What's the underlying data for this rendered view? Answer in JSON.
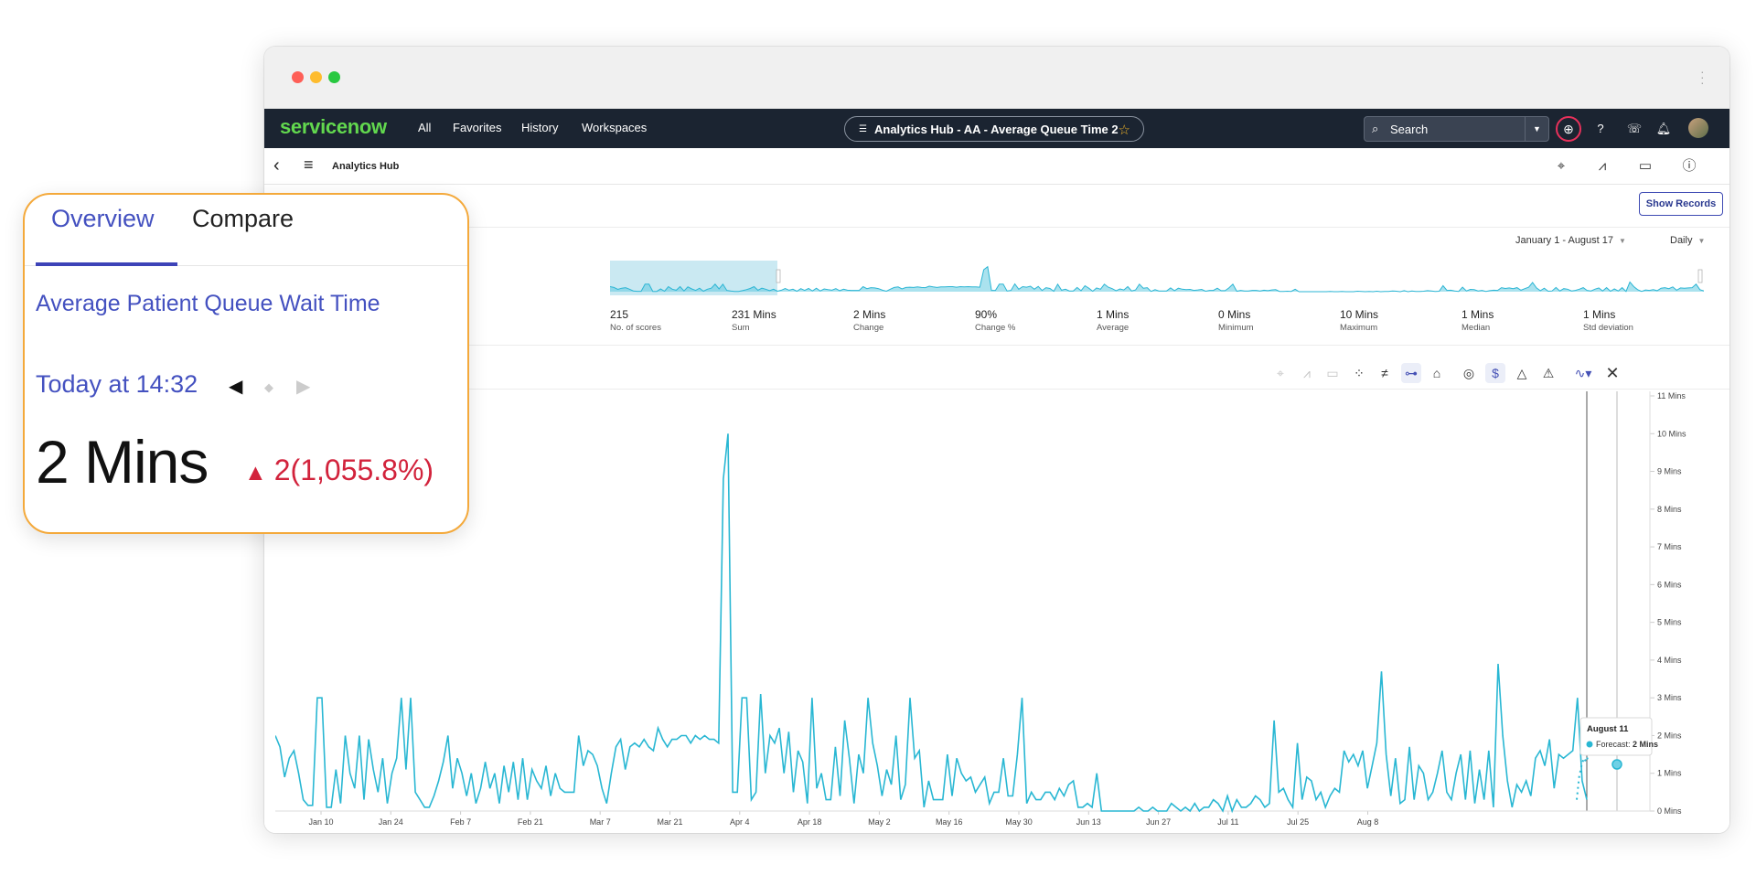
{
  "brand": {
    "logo_text": "servicenow",
    "accent_green": "#62d84e",
    "nav_bg": "#1b2431"
  },
  "nav": {
    "links": [
      "All",
      "Favorites",
      "History",
      "Workspaces"
    ],
    "page_pill": "Analytics Hub - AA - Average Queue Time 2",
    "search_placeholder": "Search",
    "icons": [
      "globe-icon",
      "help-icon",
      "phone-icon",
      "bell-icon",
      "user-avatar"
    ]
  },
  "subheader": {
    "title": "Analytics Hub",
    "icons": [
      "target-icon",
      "chart-forecast-icon",
      "comment-icon",
      "info-icon"
    ]
  },
  "header_actions": {
    "show_records": "Show Records"
  },
  "filters": {
    "date_range": "January 1 - August 17",
    "frequency": "Daily"
  },
  "stats": [
    {
      "value": "215",
      "label": "No. of scores"
    },
    {
      "value": "231 Mins",
      "label": "Sum"
    },
    {
      "value": "2 Mins",
      "label": "Change"
    },
    {
      "value": "90%",
      "label": "Change %"
    },
    {
      "value": "1 Mins",
      "label": "Average"
    },
    {
      "value": "0 Mins",
      "label": "Minimum"
    },
    {
      "value": "10 Mins",
      "label": "Maximum"
    },
    {
      "value": "1 Mins",
      "label": "Median"
    },
    {
      "value": "1 Mins",
      "label": "Std deviation"
    }
  ],
  "tooltip": {
    "date": "August 11",
    "label": "Forecast:",
    "value": "2 Mins"
  },
  "chart_data": {
    "type": "line",
    "x_tick_labels": [
      "Jan 10",
      "Jan 24",
      "Feb 7",
      "Feb 21",
      "Mar 7",
      "Mar 21",
      "Apr 4",
      "Apr 18",
      "May 2",
      "May 16",
      "May 30",
      "Jun 13",
      "Jun 27",
      "Jul 11",
      "Jul 25",
      "Aug 8"
    ],
    "y_tick_labels": [
      "0 Mins",
      "1 Mins",
      "2 Mins",
      "3 Mins",
      "4 Mins",
      "5 Mins",
      "6 Mins",
      "7 Mins",
      "8 Mins",
      "9 Mins",
      "10 Mins",
      "11 Mins"
    ],
    "ylim": [
      0,
      11
    ],
    "series": [
      {
        "values": [
          2.0,
          1.7,
          0.9,
          1.4,
          1.6,
          1.0,
          0.3,
          0.15,
          0.15,
          3.0,
          3.0,
          0.1,
          0.1,
          1.1,
          0.2,
          2.0,
          1.0,
          0.6,
          2.0,
          0.3,
          1.9,
          1.1,
          0.5,
          1.4,
          0.2,
          1.0,
          1.4,
          3.0,
          1.1,
          3.0,
          0.5,
          0.3,
          0.1,
          0.1,
          0.4,
          0.8,
          1.3,
          2.0,
          0.6,
          1.4,
          1.0,
          0.4,
          1.0,
          0.2,
          0.6,
          1.3,
          0.6,
          1.0,
          0.2,
          1.2,
          0.5,
          1.3,
          0.3,
          1.4,
          0.3,
          1.1,
          0.8,
          0.6,
          1.2,
          0.4,
          1.0,
          0.6,
          0.5,
          0.5,
          0.5,
          2.0,
          1.2,
          1.6,
          1.5,
          1.2,
          0.6,
          0.2,
          1.0,
          1.7,
          1.9,
          1.1,
          1.7,
          1.8,
          1.7,
          1.9,
          1.7,
          1.6,
          2.2,
          1.9,
          1.7,
          1.9,
          1.9,
          2.0,
          2.0,
          1.8,
          2.0,
          1.9,
          2.0,
          1.9,
          1.9,
          1.8,
          8.8,
          10.0,
          0.5,
          0.5,
          3.0,
          3.0,
          0.3,
          0.5,
          3.1,
          1.0,
          2.0,
          1.8,
          2.2,
          1.0,
          2.1,
          0.5,
          1.6,
          1.3,
          0.2,
          3.0,
          0.6,
          1.0,
          0.3,
          0.3,
          1.7,
          0.4,
          2.4,
          1.4,
          0.2,
          1.5,
          1.0,
          3.0,
          1.8,
          1.2,
          0.4,
          1.1,
          0.7,
          2.0,
          0.3,
          0.7,
          3.0,
          1.4,
          1.6,
          0.1,
          0.8,
          0.3,
          0.3,
          0.3,
          1.5,
          0.4,
          1.4,
          1.0,
          0.8,
          0.9,
          0.5,
          0.7,
          0.9,
          0.2,
          0.5,
          0.5,
          1.4,
          0.4,
          0.4,
          1.5,
          3.0,
          0.2,
          0.5,
          0.3,
          0.3,
          0.5,
          0.5,
          0.3,
          0.6,
          0.4,
          0.7,
          0.8,
          0.1,
          0.1,
          0.2,
          0.1,
          1.0,
          0.0,
          0.0,
          0.0,
          0.0,
          0.0,
          0.0,
          0.0,
          0.0,
          0.1,
          0.0,
          0.0,
          0.1,
          0.0,
          0.0,
          0.0,
          0.2,
          0.1,
          0.0,
          0.1,
          0.0,
          0.2,
          0.0,
          0.1,
          0.1,
          0.3,
          0.2,
          0.0,
          0.4,
          0.0,
          0.3,
          0.1,
          0.1,
          0.2,
          0.4,
          0.3,
          0.1,
          0.2,
          2.4,
          0.5,
          0.6,
          0.3,
          0.1,
          1.8,
          0.3,
          0.9,
          0.8,
          0.3,
          0.5,
          0.1,
          0.4,
          0.6,
          0.5,
          1.6,
          1.3,
          1.5,
          1.2,
          1.6,
          0.6,
          1.2,
          1.8,
          3.7,
          1.5,
          0.4,
          1.4,
          0.2,
          0.3,
          1.7,
          0.3,
          1.2,
          1.0,
          0.3,
          0.5,
          1.0,
          1.6,
          0.5,
          0.3,
          1.0,
          1.5,
          0.3,
          1.6,
          0.2,
          1.1,
          0.3,
          1.6,
          0.1,
          3.9,
          2.0,
          0.8,
          0.1,
          0.7,
          0.5,
          0.8,
          0.4,
          1.4,
          1.6,
          1.2,
          1.9,
          0.6,
          1.5,
          1.4,
          1.5,
          1.6,
          3.0,
          0.8,
          0.3
        ]
      },
      {
        "values": [
          0.3,
          0.9,
          1.2,
          1.4,
          1.3,
          1.5,
          1.5,
          1.6,
          1.7,
          1.6,
          1.7,
          1.7,
          1.8,
          1.7,
          1.9,
          1.8,
          2.1,
          2.1
        ]
      }
    ]
  }
}
